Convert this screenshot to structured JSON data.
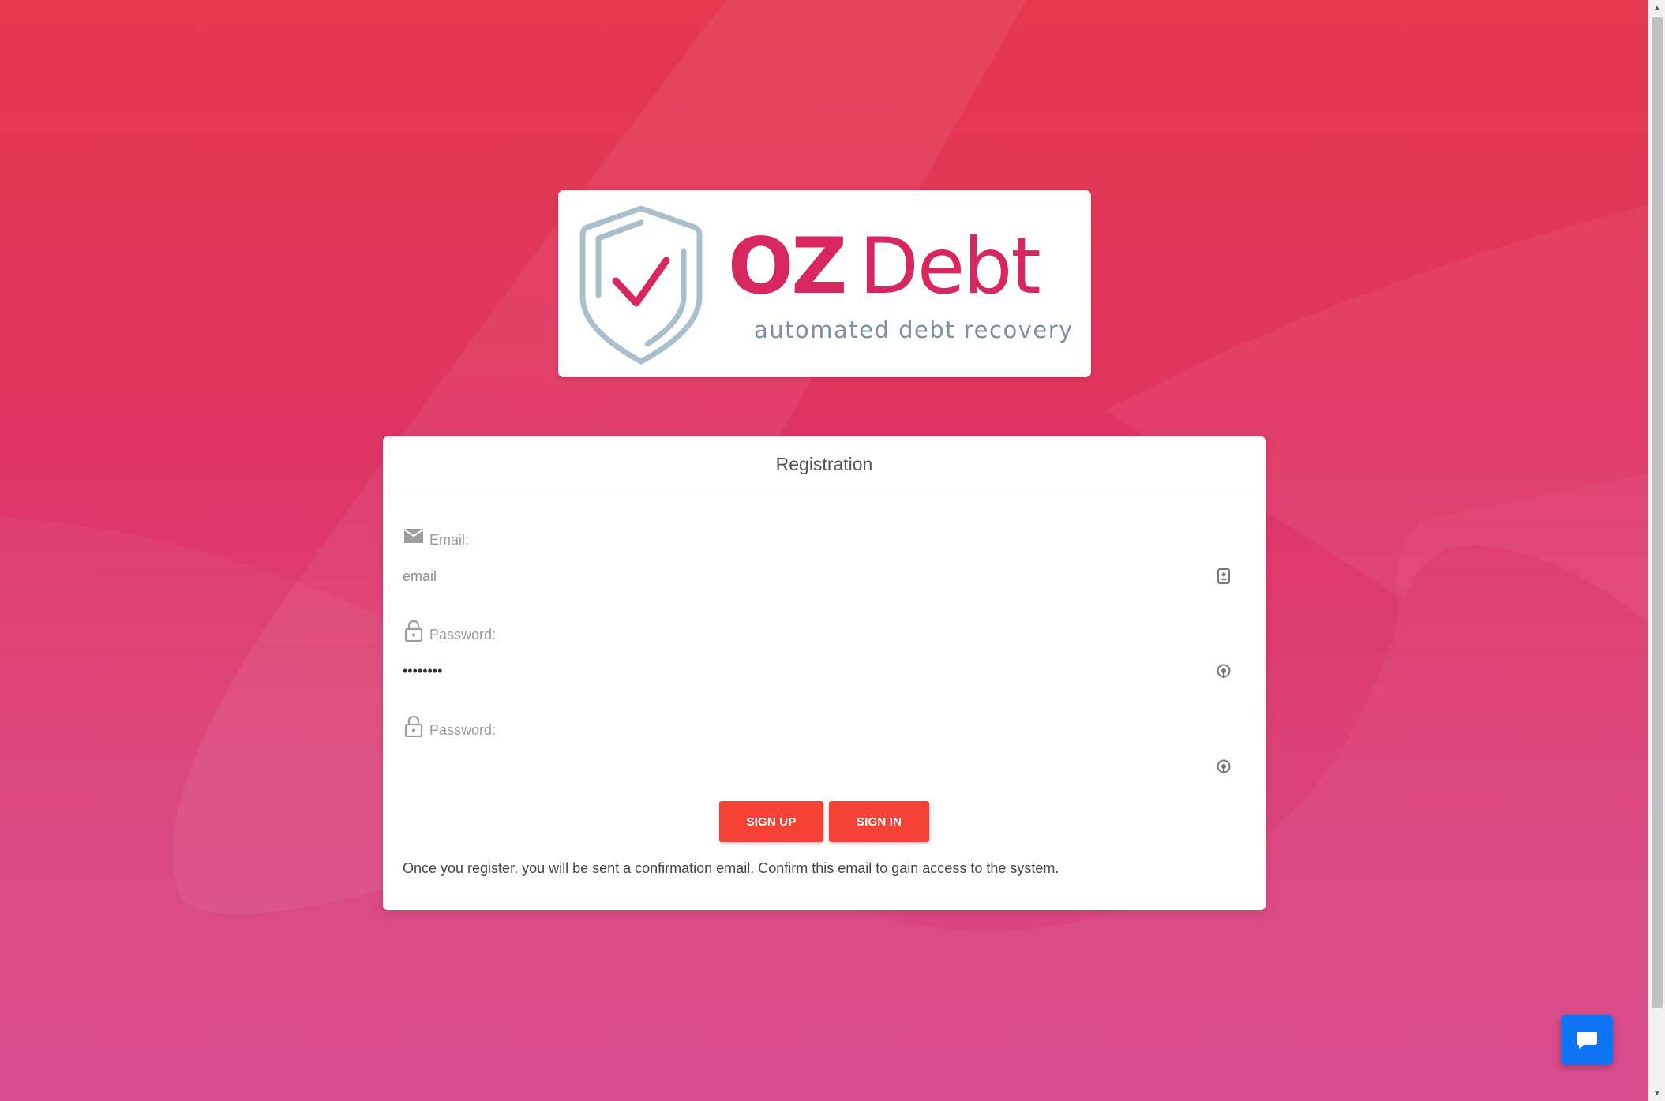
{
  "logo": {
    "brand_oz": "OZ",
    "brand_debt": "Debt",
    "tagline": "automated debt recovery",
    "shield_icon": "shield-check-icon",
    "brand_color": "#d8265e",
    "shield_color": "#a9bfcb"
  },
  "registration": {
    "title": "Registration",
    "email": {
      "label": "Email:",
      "placeholder": "email",
      "value": "",
      "icon": "envelope-icon",
      "trailing_icon": "contact-card-icon"
    },
    "password": {
      "label": "Password:",
      "placeholder": "",
      "value": "password",
      "icon": "lock-icon",
      "trailing_icon": "password-manager-icon"
    },
    "password_confirm": {
      "label": "Password:",
      "placeholder": "",
      "value": "",
      "icon": "lock-icon",
      "trailing_icon": "password-manager-icon"
    },
    "buttons": {
      "sign_up": "SIGN UP",
      "sign_in": "SIGN IN"
    },
    "info_text": "Once you register, you will be sent a confirmation email. Confirm this email to gain access to the system."
  },
  "chat": {
    "icon": "chat-bubble-icon",
    "color": "#0f75f5"
  },
  "theme": {
    "button_color": "#f44336",
    "background_top": "#e5394d",
    "background_bottom": "#d8468a"
  }
}
